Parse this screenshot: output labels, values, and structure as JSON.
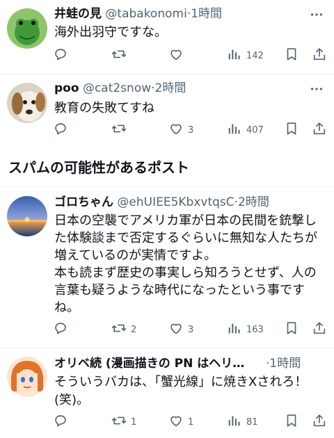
{
  "posts": [
    {
      "name": "井蛙の見",
      "handle": "@tabakonomi",
      "dot": "·",
      "time": "1時間",
      "text": "海外出羽守ですな。",
      "replies": "",
      "reposts": "",
      "likes": "",
      "views": "142"
    },
    {
      "name": "poo",
      "handle": "@cat2snow",
      "dot": "·",
      "time": "2時間",
      "text": "教育の失敗てすね",
      "replies": "",
      "reposts": "",
      "likes": "3",
      "views": "407"
    },
    {
      "name": "ゴロちゃん",
      "handle": "@ehUIEE5KbxvtqsC",
      "dot": "·",
      "time": "2時間",
      "text": "日本の空襲でアメリカ軍が日本の民間を銃撃した体験談まで否定するぐらいに無知な人たちが増えているのが実情ですよ。\n本も読まず歴史の事実しら知ろうとせず、人の言葉も疑うような時代になったという事ですね。",
      "replies": "",
      "reposts": "2",
      "likes": "3",
      "views": "163"
    },
    {
      "name": "オリベ続 (漫画描きの PN はヘリ…",
      "handle": "",
      "dot": "·",
      "time": "1時間",
      "text": "そういうバカは、「蟹光線」に焼きXされろ！\n(笑)。",
      "replies": "",
      "reposts": "1",
      "likes": "1",
      "views": "81"
    }
  ],
  "section_title": "スパムの可能性があるポスト",
  "colors": {
    "text": "#0f1419",
    "muted": "#536471",
    "divider": "#eff3f4"
  },
  "icons": [
    "more-icon",
    "reply-icon",
    "repost-icon",
    "like-icon",
    "views-icon",
    "bookmark-icon",
    "share-icon"
  ]
}
